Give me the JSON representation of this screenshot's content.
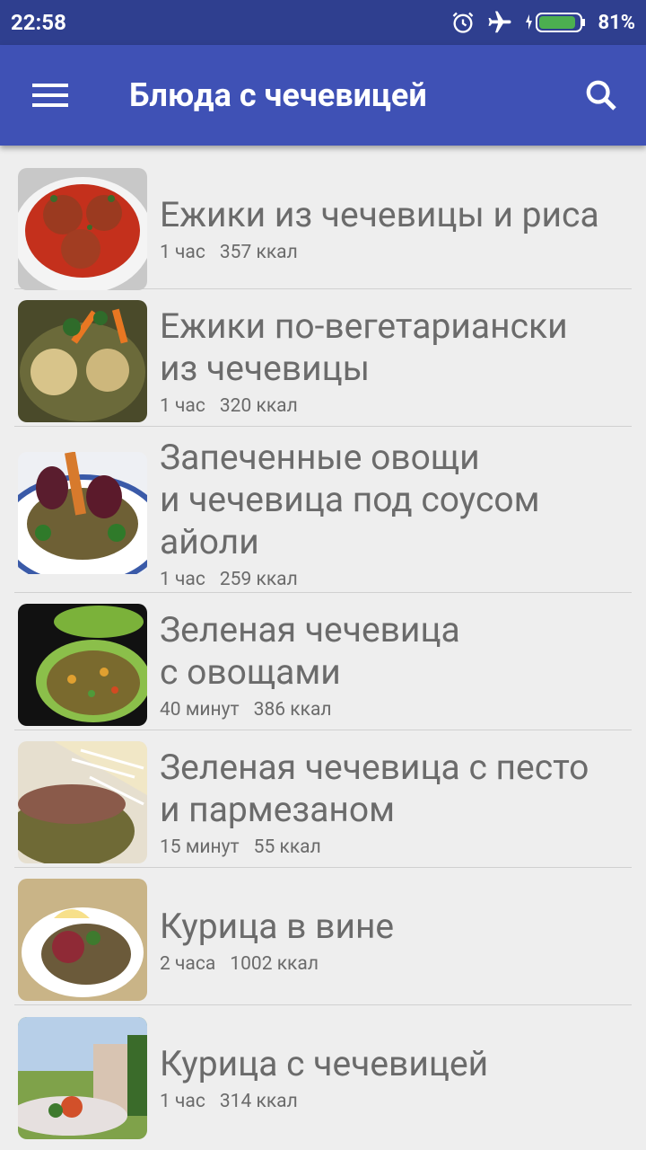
{
  "status": {
    "time": "22:58",
    "battery": "81%"
  },
  "appbar": {
    "title": "Блюда с чечевицей"
  },
  "recipes": [
    {
      "line1": "Ежики из чечевицы и риса",
      "line2": "",
      "line3": "",
      "time": "1 час",
      "kcal": "357 ккал"
    },
    {
      "line1": "Ежики по-вегетариански",
      "line2": "из чечевицы",
      "line3": "",
      "time": "1 час",
      "kcal": "320 ккал"
    },
    {
      "line1": "Запеченные овощи",
      "line2": "и чечевица под соусом",
      "line3": "айоли",
      "time": "1 час",
      "kcal": "259 ккал"
    },
    {
      "line1": "Зеленая чечевица",
      "line2": "с овощами",
      "line3": "",
      "time": "40 минут",
      "kcal": "386 ккал"
    },
    {
      "line1": "Зеленая чечевица с песто",
      "line2": "и пармезаном",
      "line3": "",
      "time": "15 минут",
      "kcal": "55 ккал"
    },
    {
      "line1": "Курица в вине",
      "line2": "",
      "line3": "",
      "time": "2 часа",
      "kcal": "1002 ккал"
    },
    {
      "line1": "Курица с чечевицей",
      "line2": "",
      "line3": "",
      "time": "1 час",
      "kcal": "314 ккал"
    }
  ]
}
